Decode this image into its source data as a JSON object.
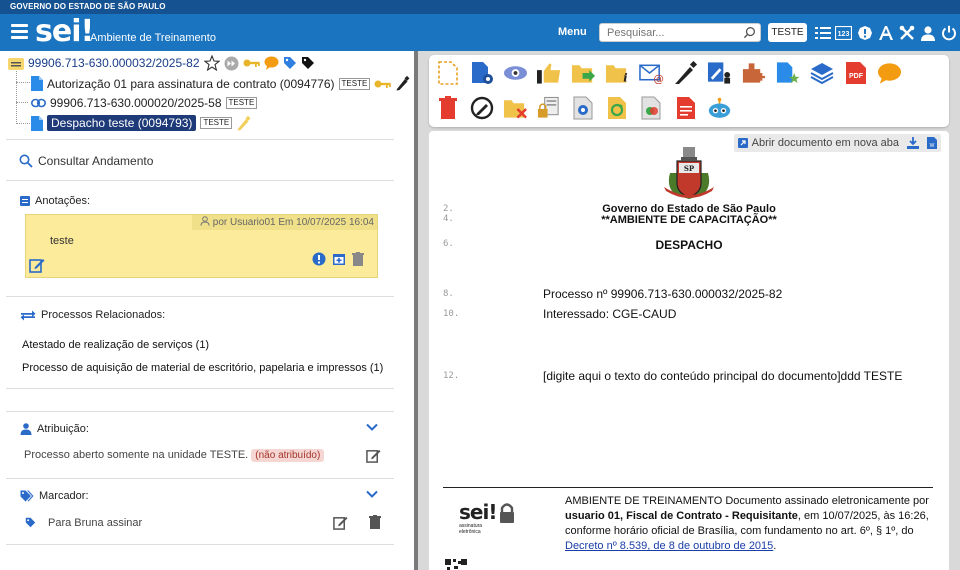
{
  "gov_bar": "GOVERNO DO ESTADO DE SÃO PAULO",
  "header": {
    "logo": "sei!",
    "env_title": "Ambiente de Treinamento",
    "menu": "Menu",
    "search_placeholder": "Pesquisar...",
    "unit": "TESTE",
    "colors": {
      "bar": "#155291",
      "header": "#1a74c0"
    }
  },
  "tree": {
    "process": "99906.713-630.000032/2025-82",
    "items": [
      {
        "label": "Autorização 01 para assinatura de contrato (0094776)",
        "badge": "TESTE"
      },
      {
        "label": "99906.713-630.000020/2025-58",
        "badge": "TESTE"
      },
      {
        "label": "Despacho teste (0094793)",
        "badge": "TESTE"
      }
    ]
  },
  "left": {
    "consult": "Consultar Andamento",
    "notes_label": "Anotações:",
    "note_meta": "por Usuario01 Em 10/07/2025 16:04",
    "note_text": "teste",
    "related_label": "Processos Relacionados:",
    "related": [
      "Atestado de realização de serviços (1)",
      "Processo de aquisição de material de escritório, papelaria e impressos (1)"
    ],
    "assign_label": "Atribuição:",
    "assign_text": "Processo aberto somente na unidade TESTE.",
    "assign_tag": "(não atribuído)",
    "marker_label": "Marcador:",
    "marker_text": "Para Bruna assinar"
  },
  "doc": {
    "open_new": "Abrir documento em nova aba",
    "gov": "Governo do Estado de São Paulo",
    "env": "**AMBIENTE DE CAPACITAÇÃO**",
    "title": "DESPACHO",
    "line_numbers": [
      "2.",
      "4.",
      "6.",
      "8.",
      "10.",
      "12."
    ],
    "processo": "Processo nº 99906.713-630.000032/2025-82",
    "interessado": "Interessado: CGE-CAUD",
    "body": "[digite aqui o texto do conteúdo principal do documento]ddd TESTE",
    "sig_pre": "AMBIENTE DE TREINAMENTO Documento assinado eletronicamente por",
    "sig_bold": "usuario 01, Fiscal de Contrato - Requisitante",
    "sig_mid": ", em 10/07/2025, às 16:26, conforme horário oficial de Brasília, com fundamento no art. 6º, § 1º, do",
    "sig_link": "Decreto nº 8.539, de 8 de outubro de 2015",
    "sig_end": ".",
    "sig_logo": "sei!",
    "sig_logo_sub": "assinatura eletrônica"
  }
}
